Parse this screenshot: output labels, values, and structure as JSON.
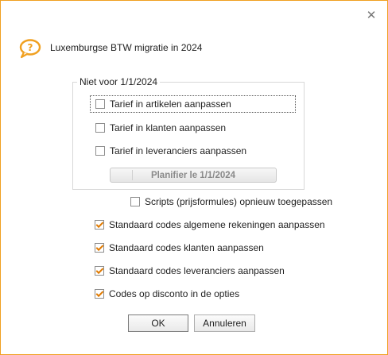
{
  "dialog": {
    "title": "Luxemburgse BTW migratie in 2024",
    "close_glyph": "✕",
    "accent_color": "#f0a020",
    "help_icon": "question-speech-bubble-icon"
  },
  "group": {
    "legend": "Niet voor 1/1/2024",
    "options": [
      {
        "label": "Tarief in artikelen aanpassen",
        "checked": false
      },
      {
        "label": "Tarief in klanten aanpassen",
        "checked": false
      },
      {
        "label": "Tarief in leveranciers aanpassen",
        "checked": false
      }
    ],
    "plan_button": "Planifier le 1/1/2024"
  },
  "options": [
    {
      "label": "Scripts (prijsformules) opnieuw toegepassen",
      "checked": false
    },
    {
      "label": "Standaard codes algemene rekeningen aanpassen",
      "checked": true
    },
    {
      "label": "Standaard codes klanten aanpassen",
      "checked": true
    },
    {
      "label": "Standaard codes leveranciers aanpassen",
      "checked": true
    },
    {
      "label": "Codes op disconto in de opties",
      "checked": true
    }
  ],
  "buttons": {
    "ok": "OK",
    "cancel": "Annuleren"
  }
}
